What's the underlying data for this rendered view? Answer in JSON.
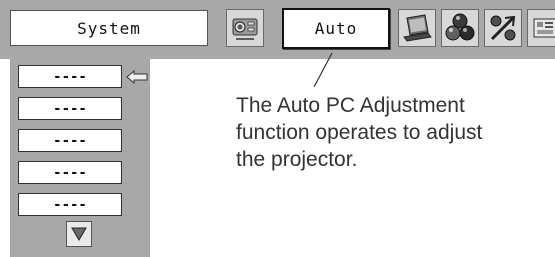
{
  "menu": {
    "category_label": "System",
    "selected_value": "Auto",
    "icons": [
      "projector-image-icon",
      "laptop-icon",
      "color-balls-icon",
      "adjust-percent-icon",
      "settings-panel-icon"
    ]
  },
  "list": {
    "items": [
      "----",
      "----",
      "----",
      "----",
      "----"
    ],
    "scroll_icon": "down-triangle-icon",
    "pointer_icon": "left-arrow-icon"
  },
  "description": {
    "line1": "The Auto PC Adjustment",
    "line2": "function operates to adjust",
    "line3": "the projector."
  },
  "colors": {
    "panel_gray": "#a8a8a8",
    "text_dark": "#333333"
  }
}
